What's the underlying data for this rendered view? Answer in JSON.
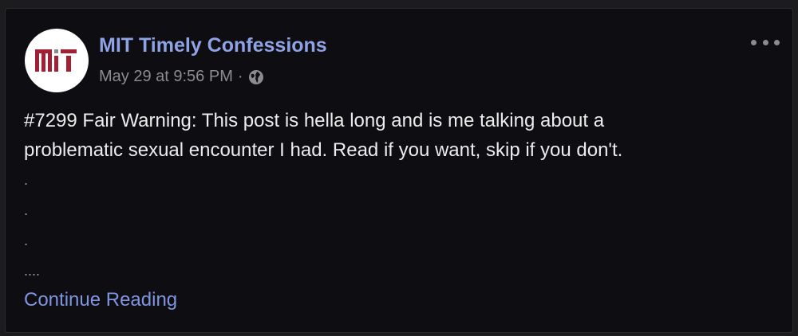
{
  "post": {
    "page_name": "MIT Timely Confessions",
    "timestamp": "May 29 at 9:56 PM",
    "separator": "·",
    "privacy_icon": "globe-icon",
    "more_icon": "more-options-icon",
    "body_lines": [
      "#7299 Fair Warning: This post is hella long and is me talking about a",
      "problematic sexual encounter I had. Read if you want, skip if you don't."
    ],
    "dots": [
      ".",
      ".",
      ".",
      "...."
    ],
    "continue_label": "Continue Reading"
  },
  "avatar": {
    "logo_text": "MIT",
    "brand_color": "#a31f34"
  },
  "colors": {
    "background": "#0e0d12",
    "link": "#8fa2e6",
    "text": "#ececec",
    "meta": "#8c8c8f"
  }
}
